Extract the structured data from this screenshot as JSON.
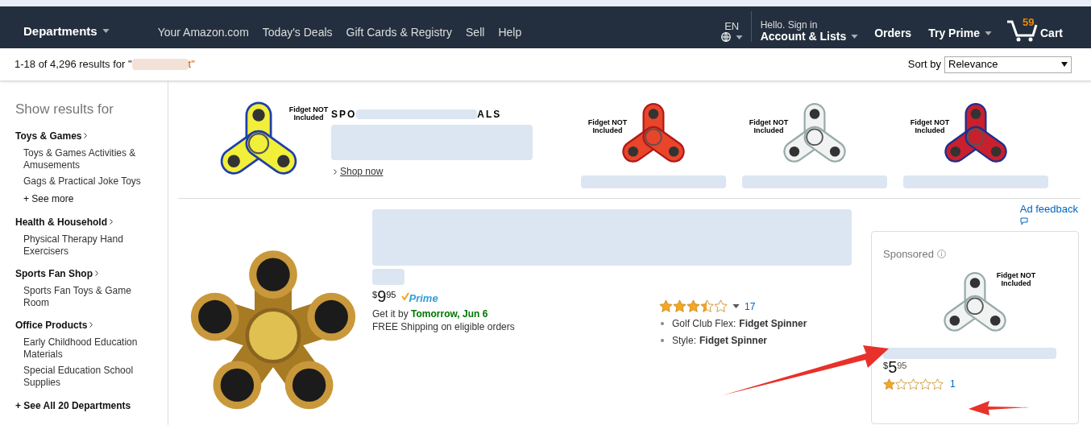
{
  "nav": {
    "departments": "Departments",
    "links": [
      "Your Amazon.com",
      "Today's Deals",
      "Gift Cards & Registry",
      "Sell",
      "Help"
    ],
    "language": "EN",
    "greeting": "Hello. Sign in",
    "account": "Account & Lists",
    "orders": "Orders",
    "prime": "Try Prime",
    "cart_count": "59",
    "cart": "Cart"
  },
  "results_bar": {
    "summary": "1-18 of 4,296 results for \"",
    "query_tail": "t\"",
    "sort_label": "Sort by",
    "sort_value": "Relevance"
  },
  "sidebar": {
    "title": "Show results for",
    "categories": [
      {
        "name": "Toys & Games",
        "children": [
          "Toys & Games Activities & Amusements",
          "Gags & Practical Joke Toys"
        ],
        "more": "+ See more"
      },
      {
        "name": "Health & Household",
        "children": [
          "Physical Therapy Hand Exercisers"
        ]
      },
      {
        "name": "Sports Fan Shop",
        "children": [
          "Sports Fan Toys & Game Room"
        ]
      },
      {
        "name": "Office Products",
        "children": [
          "Early Childhood Education Materials",
          "Special Education School Supplies"
        ]
      }
    ],
    "see_all": "+ See All 20 Departments"
  },
  "banner": {
    "heading": "SPO",
    "heading_tail": "ALS",
    "shop_now": "Shop now",
    "image_label": "Fidget NOT Included",
    "products": [
      {
        "image_label": "Fidget NOT Included"
      },
      {
        "image_label": "Fidget NOT Included"
      },
      {
        "image_label": "Fidget NOT Included"
      }
    ],
    "ad_feedback": "Ad feedback"
  },
  "result": {
    "prime_logo": "Prime",
    "price_currency": "$",
    "price_whole": "9",
    "price_fraction": "95",
    "delivery_prefix": "Get it by ",
    "delivery_date": "Tomorrow, Jun 6",
    "shipping": "FREE Shipping on eligible orders",
    "stars": 3.5,
    "review_count": "17",
    "attributes": [
      {
        "label": "Golf Club Flex:",
        "value": "Fidget Spinner"
      },
      {
        "label": "Style:",
        "value": "Fidget Spinner"
      }
    ]
  },
  "sponsored": {
    "label": "Sponsored",
    "image_label": "Fidget NOT Included",
    "price_currency": "$",
    "price_whole": "5",
    "price_fraction": "95",
    "stars": 1,
    "review_count": "1"
  }
}
